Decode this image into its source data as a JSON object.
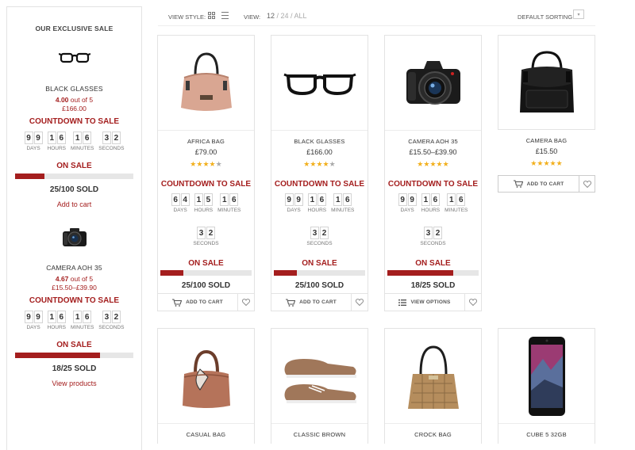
{
  "toolbar": {
    "view_style_label": "VIEW STYLE:",
    "view_label": "VIEW:",
    "view_current": "12",
    "view_options": "/ 24 / ALL",
    "sort_label": "DEFAULT SORTING"
  },
  "sidebar": {
    "title": "OUR EXCLUSIVE SALE",
    "items": [
      {
        "name": "BLACK GLASSES",
        "rating": "4.00",
        "rating_suffix": "out of 5",
        "price": "£166.00",
        "countdown_title": "COUNTDOWN TO SALE",
        "countdown": [
          {
            "digits": [
              "9",
              "9"
            ],
            "label": "DAYS"
          },
          {
            "digits": [
              "1",
              "6"
            ],
            "label": "HOURS"
          },
          {
            "digits": [
              "1",
              "6"
            ],
            "label": "MINUTES"
          },
          {
            "digits": [
              "3",
              "2"
            ],
            "label": "SECONDS"
          }
        ],
        "sale_label": "ON SALE",
        "sold_fraction": 0.25,
        "sold_text": "25/100 SOLD",
        "link": "Add to cart"
      },
      {
        "name": "CAMERA AOH 35",
        "rating": "4.67",
        "rating_suffix": "out of 5",
        "price": "£15.50–£39.90",
        "countdown_title": "COUNTDOWN TO SALE",
        "countdown": [
          {
            "digits": [
              "9",
              "9"
            ],
            "label": "DAYS"
          },
          {
            "digits": [
              "1",
              "6"
            ],
            "label": "HOURS"
          },
          {
            "digits": [
              "1",
              "6"
            ],
            "label": "MINUTES"
          },
          {
            "digits": [
              "3",
              "2"
            ],
            "label": "SECONDS"
          }
        ],
        "sale_label": "ON SALE",
        "sold_fraction": 0.72,
        "sold_text": "18/25 SOLD",
        "link": "View products"
      }
    ]
  },
  "products": [
    {
      "name": "AFRICA BAG",
      "price": "£79.00",
      "stars": 4,
      "image": "handbag-pink",
      "countdown_title": "COUNTDOWN TO SALE",
      "countdown_row1": [
        {
          "digits": [
            "6",
            "4"
          ],
          "label": "DAYS"
        },
        {
          "digits": [
            "1",
            "5"
          ],
          "label": "HOURS"
        },
        {
          "digits": [
            "1",
            "6"
          ],
          "label": "MINUTES"
        }
      ],
      "countdown_row2": [
        {
          "digits": [
            "3",
            "2"
          ],
          "label": "SECONDS"
        }
      ],
      "sale_label": "ON SALE",
      "sold_fraction": 0.25,
      "sold_text": "25/100 SOLD",
      "button": "ADD TO CART",
      "button_icon": "cart-icon"
    },
    {
      "name": "BLACK GLASSES",
      "price": "£166.00",
      "stars": 4,
      "image": "glasses",
      "countdown_title": "COUNTDOWN TO SALE",
      "countdown_row1": [
        {
          "digits": [
            "9",
            "9"
          ],
          "label": "DAYS"
        },
        {
          "digits": [
            "1",
            "6"
          ],
          "label": "HOURS"
        },
        {
          "digits": [
            "1",
            "6"
          ],
          "label": "MINUTES"
        }
      ],
      "countdown_row2": [
        {
          "digits": [
            "3",
            "2"
          ],
          "label": "SECONDS"
        }
      ],
      "sale_label": "ON SALE",
      "sold_fraction": 0.25,
      "sold_text": "25/100 SOLD",
      "button": "ADD TO CART",
      "button_icon": "cart-icon"
    },
    {
      "name": "CAMERA AOH 35",
      "price": "£15.50–£39.90",
      "stars": 5,
      "image": "camera",
      "countdown_title": "COUNTDOWN TO SALE",
      "countdown_row1": [
        {
          "digits": [
            "9",
            "9"
          ],
          "label": "DAYS"
        },
        {
          "digits": [
            "1",
            "6"
          ],
          "label": "HOURS"
        },
        {
          "digits": [
            "1",
            "6"
          ],
          "label": "MINUTES"
        }
      ],
      "countdown_row2": [
        {
          "digits": [
            "3",
            "2"
          ],
          "label": "SECONDS"
        }
      ],
      "sale_label": "ON SALE",
      "sold_fraction": 0.72,
      "sold_text": "18/25 SOLD",
      "button": "VIEW OPTIONS",
      "button_icon": "list-icon"
    },
    {
      "name": "CAMERA BAG",
      "price": "£15.50",
      "stars": 5,
      "image": "camera-bag",
      "button": "ADD TO CART",
      "button_icon": "cart-icon"
    },
    {
      "name": "CASUAL BAG",
      "image": "handbag-brown"
    },
    {
      "name": "CLASSIC BROWN",
      "image": "shoes"
    },
    {
      "name": "CROCK BAG",
      "image": "handbag-croc"
    },
    {
      "name": "CUBE 5 32GB",
      "image": "phone"
    }
  ],
  "colors": {
    "accent": "#a41e1e",
    "star": "#f2b01e",
    "border": "#e3e3e3"
  }
}
